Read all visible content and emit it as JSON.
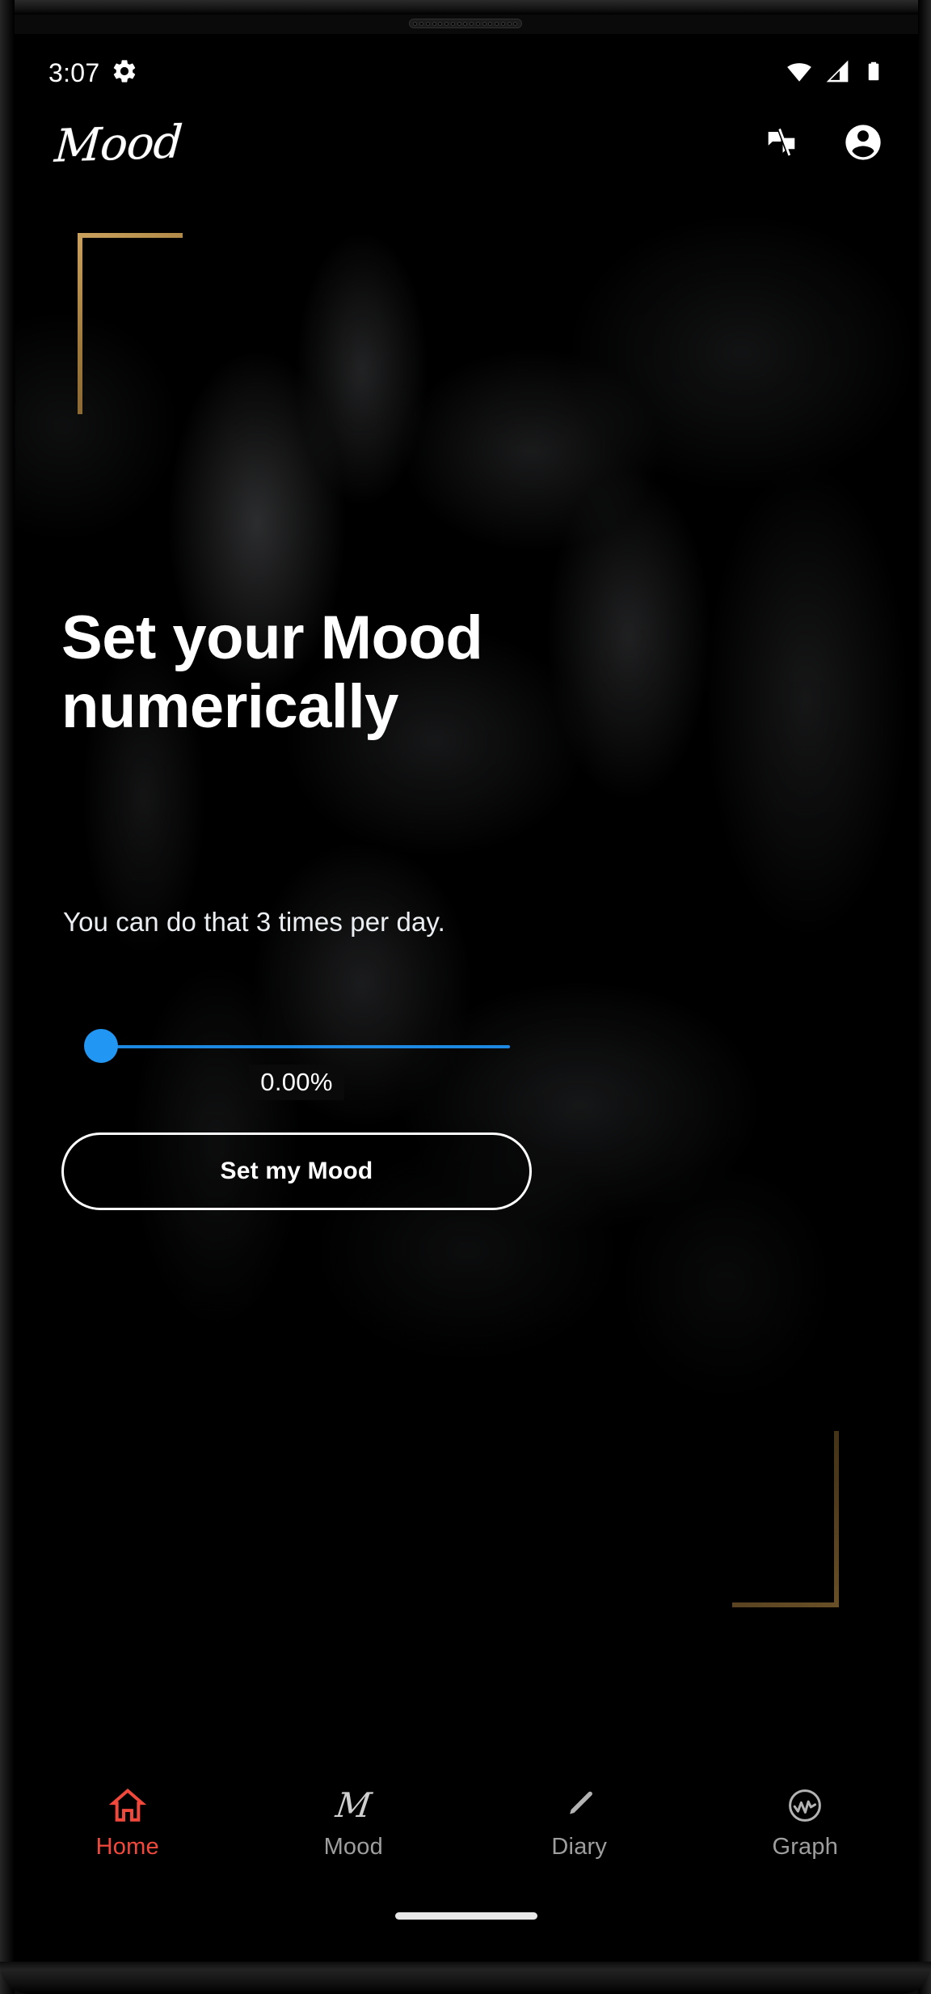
{
  "status_bar": {
    "time": "3:07",
    "icons_left": [
      "gear-icon"
    ],
    "icons_right": [
      "wifi-icon",
      "cellular-signal-icon",
      "battery-icon"
    ]
  },
  "app_bar": {
    "brand": "Mood",
    "actions": [
      "speaker-notes-off-icon",
      "account-circle-icon"
    ]
  },
  "hero": {
    "headline": "Set your Mood numerically",
    "subline": "You can do that 3 times per day.",
    "accent_gold": "#a07a3c",
    "frame_names": [
      "gold-corner-frame-top-left",
      "gold-corner-frame-bottom-right"
    ]
  },
  "slider": {
    "value_label": "0.00%",
    "value": 0,
    "min": 0,
    "max": 100,
    "thumb_color": "#2196f3",
    "track_color": "#1e88e5"
  },
  "primary_action": {
    "label": "Set my Mood"
  },
  "bottom_nav": {
    "active_color": "#f2483c",
    "inactive_color": "#9e9e9e",
    "items": [
      {
        "label": "Home",
        "icon": "home-icon",
        "active": true
      },
      {
        "label": "Mood",
        "icon": "mood-script-m-icon",
        "glyph": "M",
        "active": false
      },
      {
        "label": "Diary",
        "icon": "pencil-icon",
        "active": false
      },
      {
        "label": "Graph",
        "icon": "graph-circle-icon",
        "active": false
      }
    ]
  }
}
